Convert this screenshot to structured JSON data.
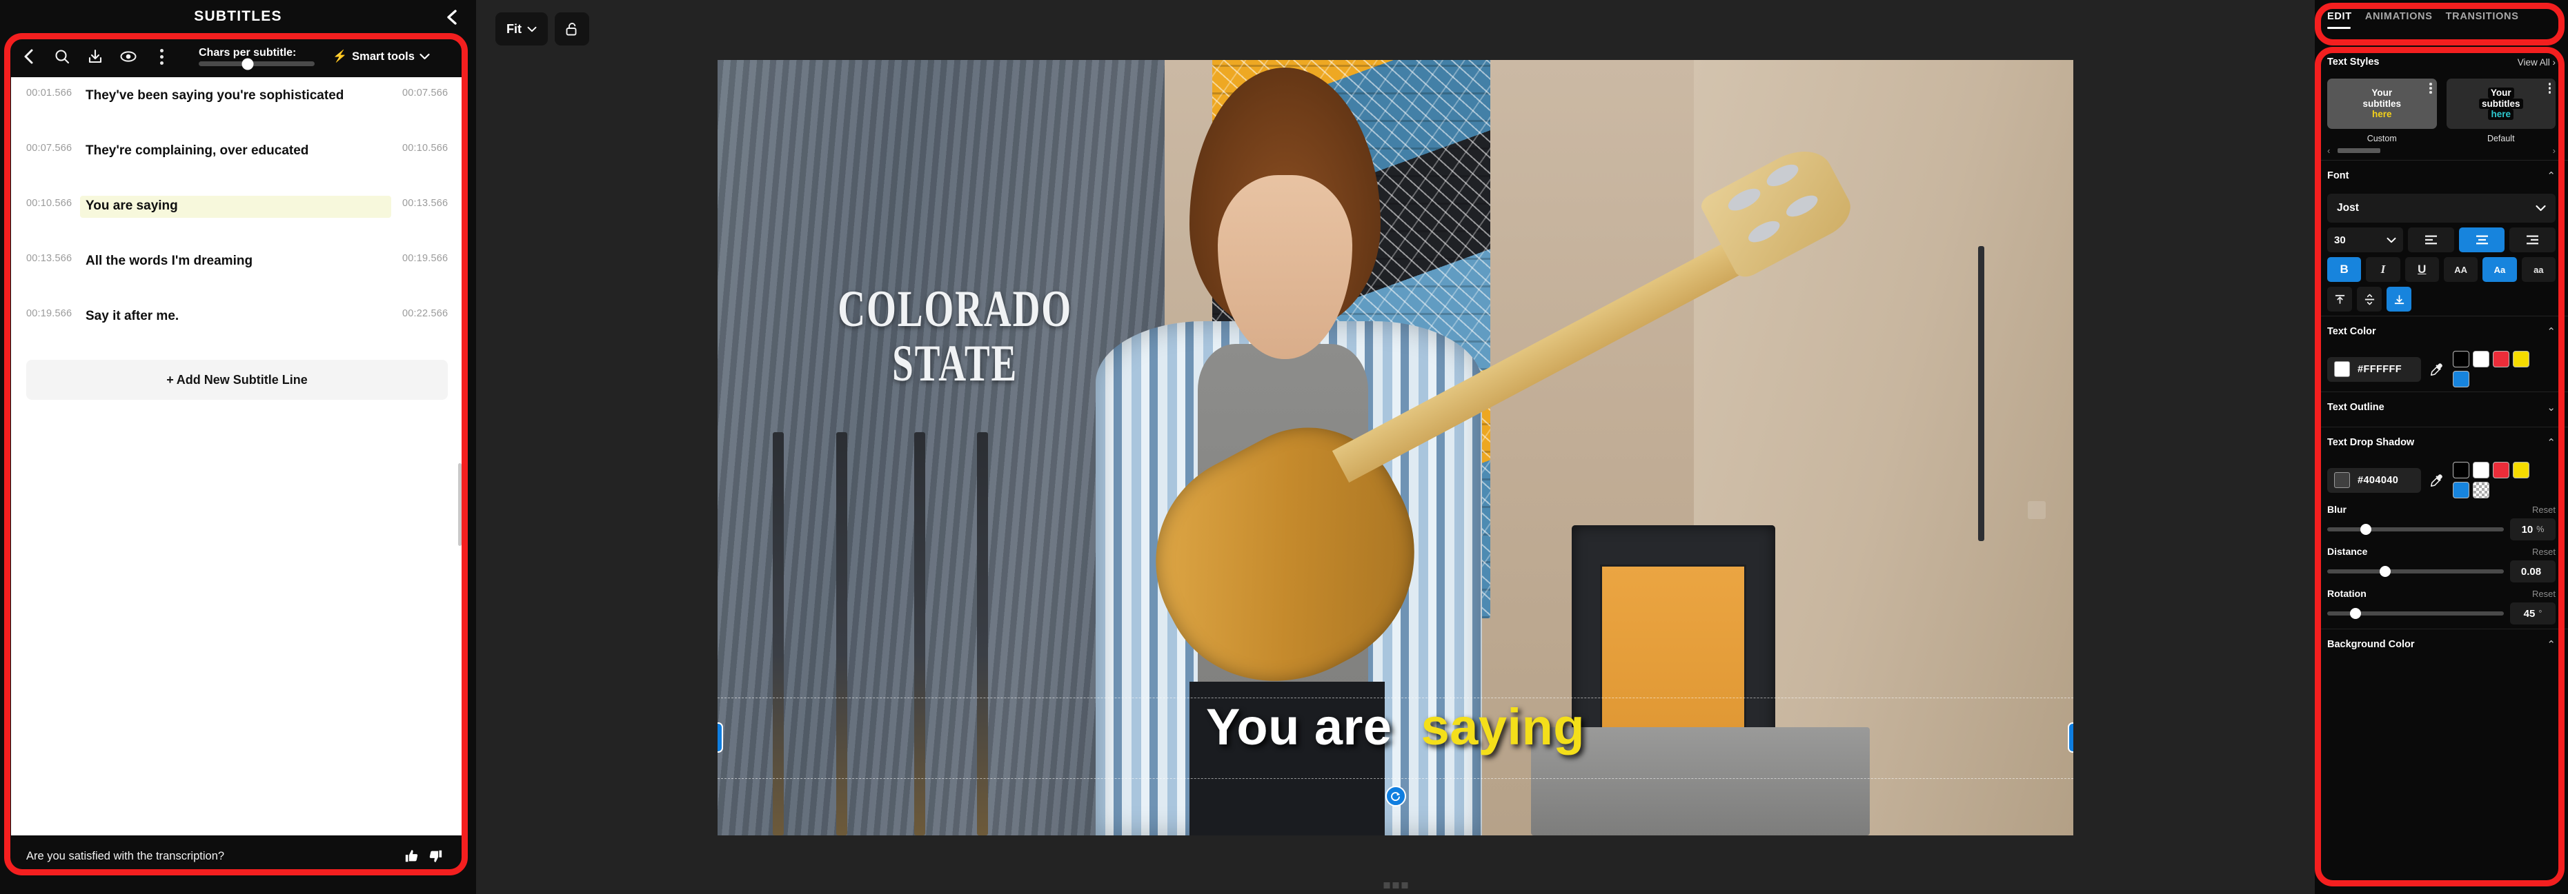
{
  "left_panel": {
    "title": "SUBTITLES",
    "collapse_icon": "chevron-left-icon",
    "toolbar": {
      "back_icon": "chevron-left-icon",
      "search_icon": "search-icon",
      "download_icon": "download-icon",
      "preview_icon": "eye-icon",
      "more_icon": "more-vertical-icon",
      "chars_label": "Chars per subtitle:",
      "chars_value": 42,
      "smart_tools_label": "Smart tools",
      "smart_tools_icon": "lightning-bolt-icon",
      "smart_tools_caret": "chevron-down-icon"
    },
    "subtitles": [
      {
        "start": "00:01.566",
        "end": "00:07.566",
        "text": "They've been saying you're sophisticated",
        "active": false
      },
      {
        "start": "00:07.566",
        "end": "00:10.566",
        "text": "They're complaining, over educated",
        "active": false
      },
      {
        "start": "00:10.566",
        "end": "00:13.566",
        "text": "You are saying",
        "active": true
      },
      {
        "start": "00:13.566",
        "end": "00:19.566",
        "text": "All the words I'm dreaming",
        "active": false
      },
      {
        "start": "00:19.566",
        "end": "00:22.566",
        "text": "Say it after me.",
        "active": false
      }
    ],
    "add_line_label": "Add New Subtitle Line",
    "add_line_plus": "+",
    "feedback": {
      "question": "Are you satisfied with the transcription?",
      "thumbs_up_icon": "thumbs-up-icon",
      "thumbs_down_icon": "thumbs-down-icon"
    }
  },
  "center": {
    "fit_label": "Fit",
    "fit_caret": "chevron-down-icon",
    "lock_icon": "unlock-icon",
    "video": {
      "shirt_text_line1": "COLORADO",
      "shirt_text_line2": "STATE",
      "subtitle_white": "You are",
      "subtitle_highlight": "saying",
      "rotate_icon": "rotate-handle-icon"
    }
  },
  "right_panel": {
    "tabs": [
      {
        "label": "EDIT",
        "active": true
      },
      {
        "label": "ANIMATIONS",
        "active": false
      },
      {
        "label": "TRANSITIONS",
        "active": false
      }
    ],
    "text_styles": {
      "title": "Text Styles",
      "view_all": "View All ›",
      "cards": [
        {
          "name": "Custom",
          "line1": "Your",
          "line2": "subtitles",
          "line3": "here",
          "highlight_color": "#f3d01a",
          "boxed": false
        },
        {
          "name": "Default",
          "line1": "Your",
          "line2": "subtitles",
          "line3": "here",
          "highlight_color": "#2ec8cf",
          "boxed": true
        }
      ],
      "prev_arrow": "chevron-left-icon",
      "next_arrow": "chevron-right-icon"
    },
    "font": {
      "title": "Font",
      "collapse_caret": "chevron-up-icon",
      "family": "Jost",
      "family_caret": "chevron-down-icon",
      "size": "30",
      "size_caret": "chevron-down-icon",
      "align": [
        {
          "name": "align-left-icon",
          "active": false
        },
        {
          "name": "align-center-icon",
          "active": true
        },
        {
          "name": "align-right-icon",
          "active": false
        }
      ],
      "styles": [
        {
          "label": "B",
          "name": "bold-button",
          "active": true
        },
        {
          "label": "I",
          "name": "italic-button",
          "active": false
        },
        {
          "label": "U",
          "name": "underline-button",
          "active": false
        },
        {
          "label": "AA",
          "name": "uppercase-button",
          "active": false
        },
        {
          "label": "Aa",
          "name": "capitalize-button",
          "active": true
        },
        {
          "label": "aa",
          "name": "lowercase-button",
          "active": false
        }
      ],
      "vertical_align": [
        {
          "name": "align-top-icon",
          "active": false
        },
        {
          "name": "align-middle-icon",
          "active": false
        },
        {
          "name": "align-bottom-icon",
          "active": true
        }
      ]
    },
    "text_color": {
      "title": "Text Color",
      "collapse_caret": "chevron-up-icon",
      "hex": "#FFFFFF",
      "current": "#FFFFFF",
      "eyedropper_icon": "eyedropper-icon",
      "swatches": [
        "#000000",
        "#FFFFFF",
        "#EB2D3A",
        "#F5DB00",
        "#1784DD"
      ]
    },
    "text_outline": {
      "title": "Text Outline",
      "collapse_caret": "chevron-down-icon"
    },
    "text_drop_shadow": {
      "title": "Text Drop Shadow",
      "collapse_caret": "chevron-up-icon",
      "hex": "#404040",
      "current": "#404040",
      "eyedropper_icon": "eyedropper-icon",
      "swatches": [
        "#000000",
        "#FFFFFF",
        "#EB2D3A",
        "#F5DB00",
        "#1784DD",
        "transparent"
      ],
      "sliders": [
        {
          "name": "Blur",
          "reset": "Reset",
          "value": "10",
          "unit": "%",
          "pct": 22
        },
        {
          "name": "Distance",
          "reset": "Reset",
          "value": "0.08",
          "unit": "",
          "pct": 33
        },
        {
          "name": "Rotation",
          "reset": "Reset",
          "value": "45",
          "unit": "°",
          "pct": 16
        }
      ]
    },
    "background_color": {
      "title": "Background Color",
      "collapse_caret": "chevron-up-icon"
    }
  }
}
